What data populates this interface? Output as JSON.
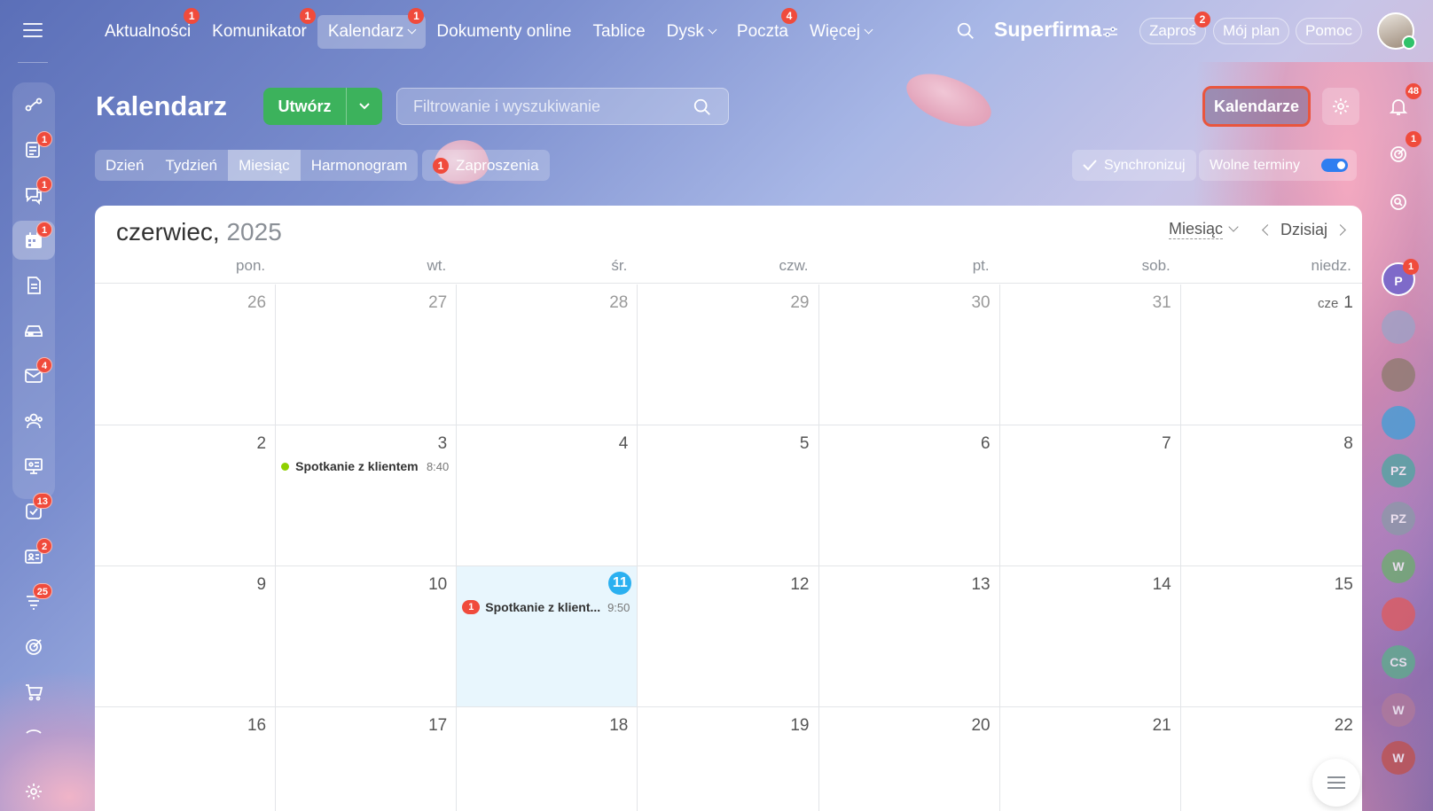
{
  "nav": {
    "items": [
      {
        "label": "Aktualności",
        "badge": "1"
      },
      {
        "label": "Komunikator",
        "badge": "1"
      },
      {
        "label": "Kalendarz",
        "badge": "1"
      },
      {
        "label": "Dokumenty online",
        "badge": ""
      },
      {
        "label": "Tablice",
        "badge": ""
      },
      {
        "label": "Dysk",
        "badge": ""
      },
      {
        "label": "Poczta",
        "badge": "4"
      },
      {
        "label": "Więcej",
        "badge": ""
      }
    ],
    "brand": "Superfirma",
    "invite_label": "Zaproś",
    "invite_badge": "2",
    "plan_label": "Mój plan",
    "help_label": "Pomoc"
  },
  "sidebar": {
    "badges": {
      "news": "1",
      "chat": "1",
      "calendar": "1",
      "mail": "4",
      "tasks": "13",
      "crm": "2",
      "automation": "25"
    }
  },
  "header": {
    "title": "Kalendarz",
    "create_label": "Utwórz",
    "search_placeholder": "Filtrowanie i wyszukiwanie",
    "calendars_label": "Kalendarze"
  },
  "views": {
    "day": "Dzień",
    "week": "Tydzień",
    "month": "Miesiąc",
    "schedule": "Harmonogram",
    "invitations_label": "Zaproszenia",
    "invitations_count": "1",
    "sync_label": "Synchronizuj",
    "free_slots_label": "Wolne terminy"
  },
  "calendar": {
    "month": "czerwiec,",
    "year": "2025",
    "mode": "Miesiąc",
    "today_label": "Dzisiaj",
    "weekdays": [
      "pon.",
      "wt.",
      "śr.",
      "czw.",
      "pt.",
      "sob.",
      "niedz."
    ],
    "weeks": [
      [
        "26",
        "27",
        "28",
        "29",
        "30",
        "31",
        "1"
      ],
      [
        "2",
        "3",
        "4",
        "5",
        "6",
        "7",
        "8"
      ],
      [
        "9",
        "10",
        "11",
        "12",
        "13",
        "14",
        "15"
      ],
      [
        "16",
        "17",
        "18",
        "19",
        "20",
        "21",
        "22"
      ]
    ],
    "first_month_prefix": "cze",
    "events": [
      {
        "name": "Spotkanie z klientem",
        "time": "8:40"
      },
      {
        "name": "Spotkanie z klient...",
        "time": "9:50",
        "badge": "1"
      }
    ]
  },
  "right_rail": {
    "notifications_badge": "48",
    "activity_badge": "1",
    "avatar_p": "P",
    "avatar_p_badge": "1",
    "avatars": [
      "PZ",
      "PZ",
      "W",
      "CS",
      "W",
      "W"
    ]
  },
  "colors": {
    "accent_green": "#3cb25c",
    "badge_red": "#f04b3c",
    "today_blue": "#2bb0f0",
    "event_green": "#8fd000",
    "highlight_orange": "#e9553d"
  }
}
